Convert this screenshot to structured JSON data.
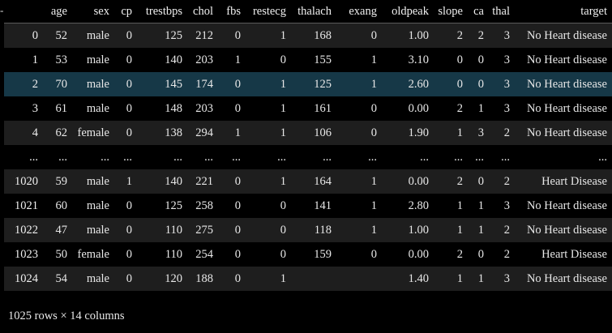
{
  "dataframe": {
    "columns": [
      "",
      "age",
      "sex",
      "cp",
      "trestbps",
      "chol",
      "fbs",
      "restecg",
      "thalach",
      "exang",
      "oldpeak",
      "slope",
      "ca",
      "thal",
      "target"
    ],
    "rows": [
      [
        "0",
        "52",
        "male",
        "0",
        "125",
        "212",
        "0",
        "1",
        "168",
        "0",
        "1.00",
        "2",
        "2",
        "3",
        "No Heart disease"
      ],
      [
        "1",
        "53",
        "male",
        "0",
        "140",
        "203",
        "1",
        "0",
        "155",
        "1",
        "3.10",
        "0",
        "0",
        "3",
        "No Heart disease"
      ],
      [
        "2",
        "70",
        "male",
        "0",
        "145",
        "174",
        "0",
        "1",
        "125",
        "1",
        "2.60",
        "0",
        "0",
        "3",
        "No Heart disease"
      ],
      [
        "3",
        "61",
        "male",
        "0",
        "148",
        "203",
        "0",
        "1",
        "161",
        "0",
        "0.00",
        "2",
        "1",
        "3",
        "No Heart disease"
      ],
      [
        "4",
        "62",
        "female",
        "0",
        "138",
        "294",
        "1",
        "1",
        "106",
        "0",
        "1.90",
        "1",
        "3",
        "2",
        "No Heart disease"
      ],
      [
        "...",
        "...",
        "...",
        "...",
        "...",
        "...",
        "...",
        "...",
        "...",
        "...",
        "...",
        "...",
        "...",
        "...",
        "..."
      ],
      [
        "1020",
        "59",
        "male",
        "1",
        "140",
        "221",
        "0",
        "1",
        "164",
        "1",
        "0.00",
        "2",
        "0",
        "2",
        "Heart Disease"
      ],
      [
        "1021",
        "60",
        "male",
        "0",
        "125",
        "258",
        "0",
        "0",
        "141",
        "1",
        "2.80",
        "1",
        "1",
        "3",
        "No Heart disease"
      ],
      [
        "1022",
        "47",
        "male",
        "0",
        "110",
        "275",
        "0",
        "0",
        "118",
        "1",
        "1.00",
        "1",
        "1",
        "2",
        "No Heart disease"
      ],
      [
        "1023",
        "50",
        "female",
        "0",
        "110",
        "254",
        "0",
        "0",
        "159",
        "0",
        "0.00",
        "2",
        "0",
        "2",
        "Heart Disease"
      ],
      [
        "1024",
        "54",
        "male",
        "0",
        "120",
        "188",
        "0",
        "1",
        "",
        "",
        "1.40",
        "1",
        "1",
        "3",
        "No Heart disease"
      ]
    ],
    "highlighted_row": 2,
    "shape_caption": "1025 rows × 14 columns"
  },
  "colors": {
    "background": "#000000",
    "row_alt": "#1e1e1e",
    "row_highlight": "#163847",
    "text": "#e8e8e8"
  }
}
